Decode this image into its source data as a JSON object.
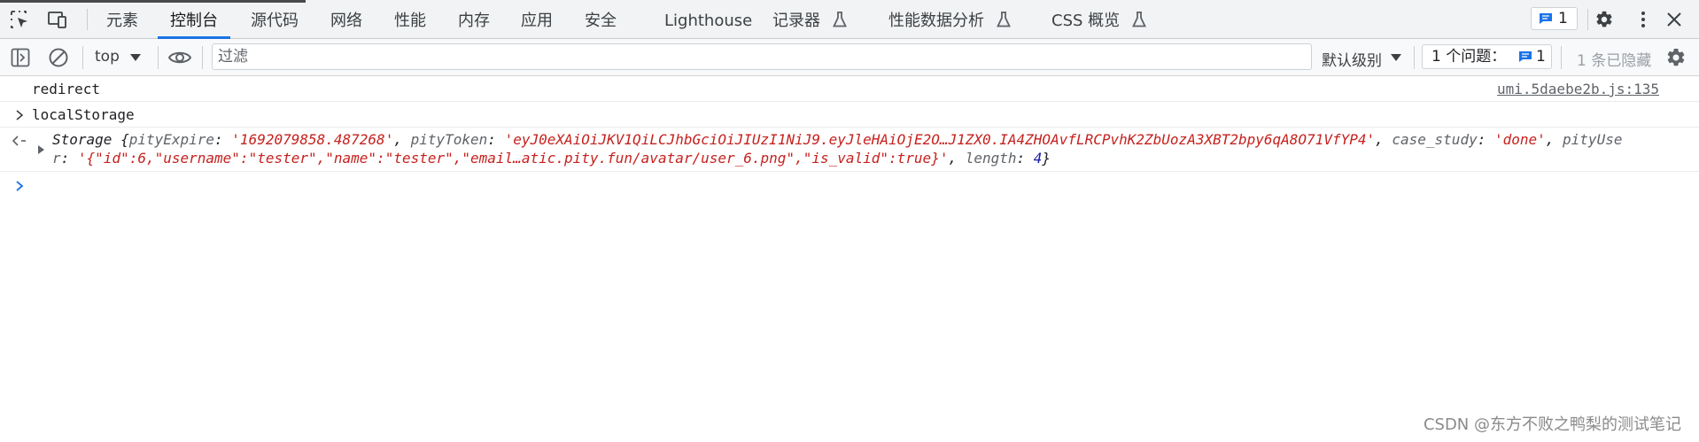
{
  "tabs": [
    "元素",
    "控制台",
    "源代码",
    "网络",
    "性能",
    "内存",
    "应用",
    "安全",
    "Lighthouse",
    "记录器",
    "性能数据分析",
    "CSS 概览"
  ],
  "active_tab": "控制台",
  "header_badge_count": "1",
  "toolbar": {
    "context": "top",
    "filter_placeholder": "过滤",
    "levels": "默认级别",
    "issues_label": "1 个问题：",
    "issues_count": "1",
    "hidden_label": "1 条已隐藏"
  },
  "console": {
    "line1": "redirect",
    "line1_source": "umi.5daebe2b.js:135",
    "line2": "localStorage",
    "storage": {
      "prefix": "Storage ",
      "open_brace": "{",
      "k1": "pityExpire",
      "v1": "'1692079858.487268'",
      "k2": "pityToken",
      "v2": "'eyJ0eXAiOiJKV1QiLCJhbGciOiJIUzI1NiJ9.eyJleHAiOjE2O…J1ZX0.IA4ZHOAvfLRCPvhK2ZbUozA3XBT2bpy6qA8O71VfYP4'",
      "k3": "case_study",
      "v3": "'done'",
      "k4_a": "pityUse",
      "k4_b": "r",
      "v4": "'{\"id\":6,\"username\":\"tester\",\"name\":\"tester\",\"email…atic.pity.fun/avatar/user_6.png\",\"is_valid\":true}'",
      "k5": "length",
      "v5": "4",
      "close_brace": "}"
    }
  },
  "watermark": "CSDN @东方不败之鸭梨的测试笔记"
}
